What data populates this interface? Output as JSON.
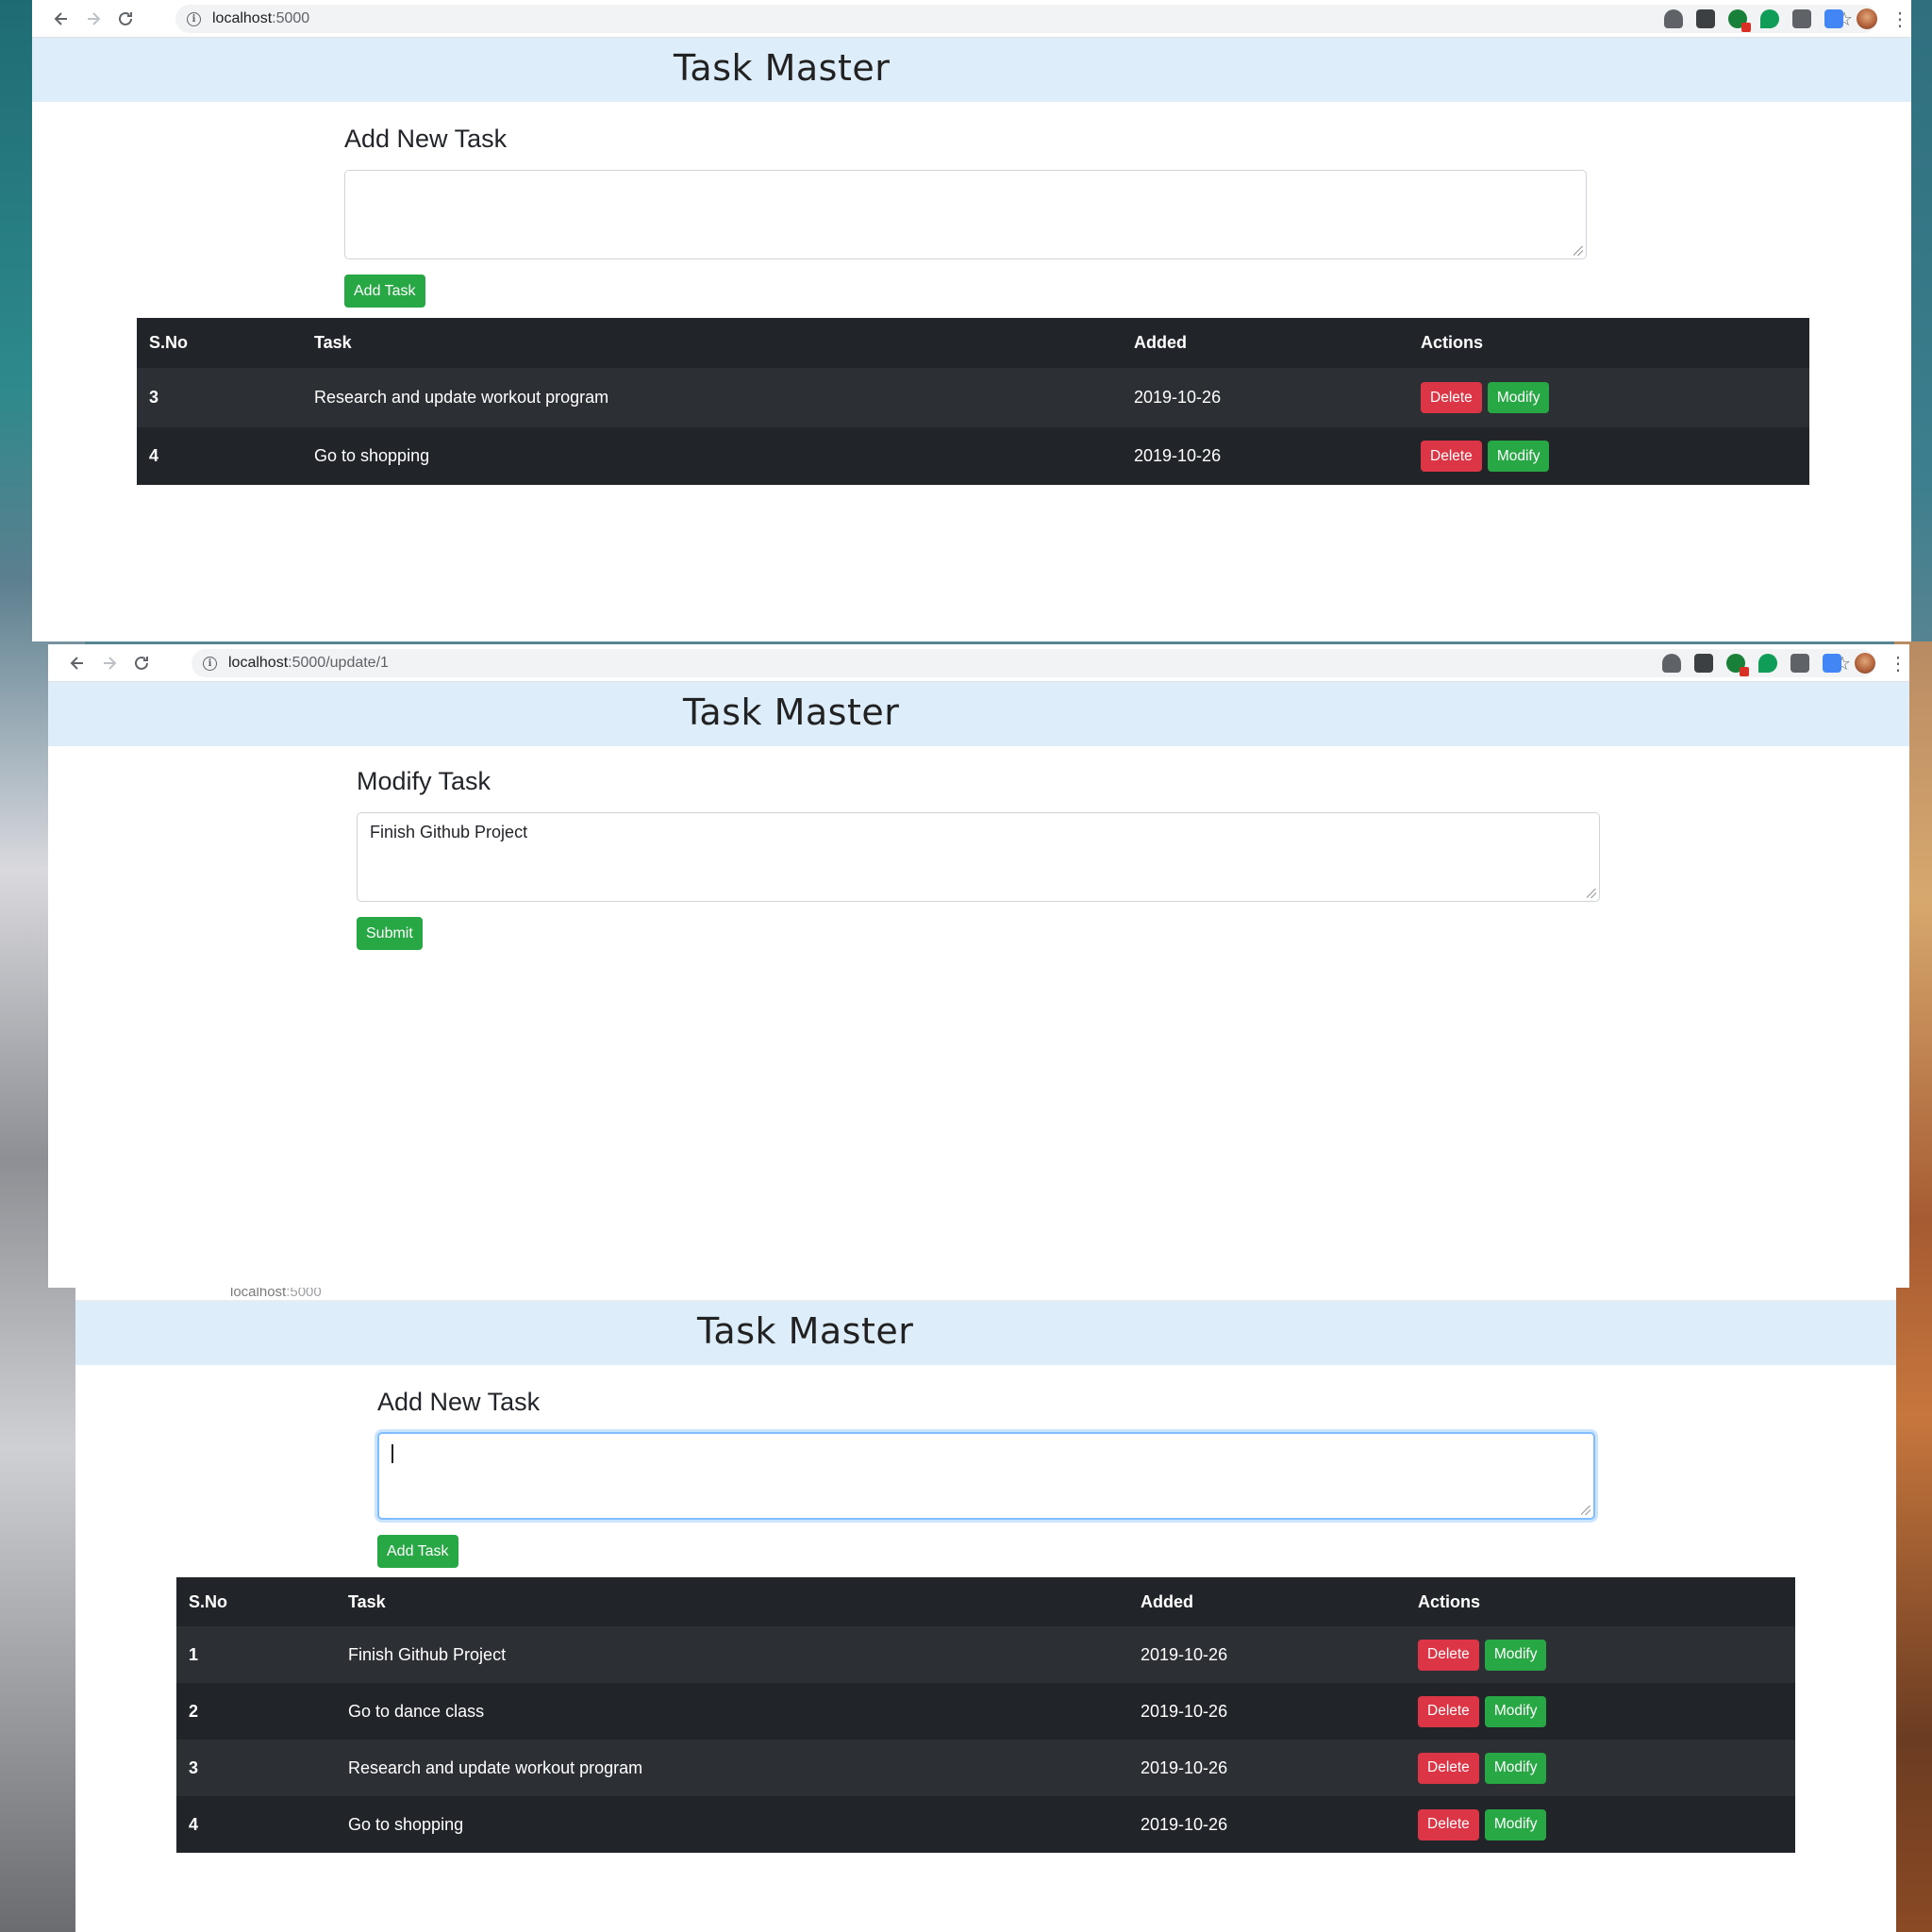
{
  "screens": [
    {
      "url_host": "localhost",
      "url_rest": ":5000",
      "app_title": "Task Master",
      "form_heading": "Add New Task",
      "textarea_value": "",
      "submit_label": "Add Task",
      "table": {
        "headers": [
          "S.No",
          "Task",
          "Added",
          "Actions"
        ],
        "rows": [
          {
            "sno": "3",
            "task": "Research and update workout program",
            "added": "2019-10-26",
            "delete": "Delete",
            "modify": "Modify"
          },
          {
            "sno": "4",
            "task": "Go to shopping",
            "added": "2019-10-26",
            "delete": "Delete",
            "modify": "Modify"
          }
        ]
      }
    },
    {
      "url_host": "localhost",
      "url_rest": ":5000/update/1",
      "app_title": "Task Master",
      "form_heading": "Modify Task",
      "textarea_value": "Finish Github Project",
      "submit_label": "Submit"
    },
    {
      "url_host": "localhost",
      "url_rest": ":5000",
      "app_title": "Task Master",
      "form_heading": "Add New Task",
      "textarea_value": "",
      "submit_label": "Add Task",
      "table": {
        "headers": [
          "S.No",
          "Task",
          "Added",
          "Actions"
        ],
        "rows": [
          {
            "sno": "1",
            "task": "Finish Github Project",
            "added": "2019-10-26",
            "delete": "Delete",
            "modify": "Modify"
          },
          {
            "sno": "2",
            "task": "Go to dance class",
            "added": "2019-10-26",
            "delete": "Delete",
            "modify": "Modify"
          },
          {
            "sno": "3",
            "task": "Research and update workout program",
            "added": "2019-10-26",
            "delete": "Delete",
            "modify": "Modify"
          },
          {
            "sno": "4",
            "task": "Go to shopping",
            "added": "2019-10-26",
            "delete": "Delete",
            "modify": "Modify"
          }
        ]
      }
    }
  ],
  "colors": {
    "header_bg": "#ddeefa",
    "table_bg": "#212529",
    "table_row_alt": "#2c3034",
    "button_green": "#28a745",
    "button_red": "#dc3545"
  },
  "icons": [
    "back-icon",
    "forward-icon",
    "reload-icon",
    "info-icon",
    "star-icon",
    "extension-icons",
    "profile-avatar",
    "menu-dots-icon"
  ]
}
